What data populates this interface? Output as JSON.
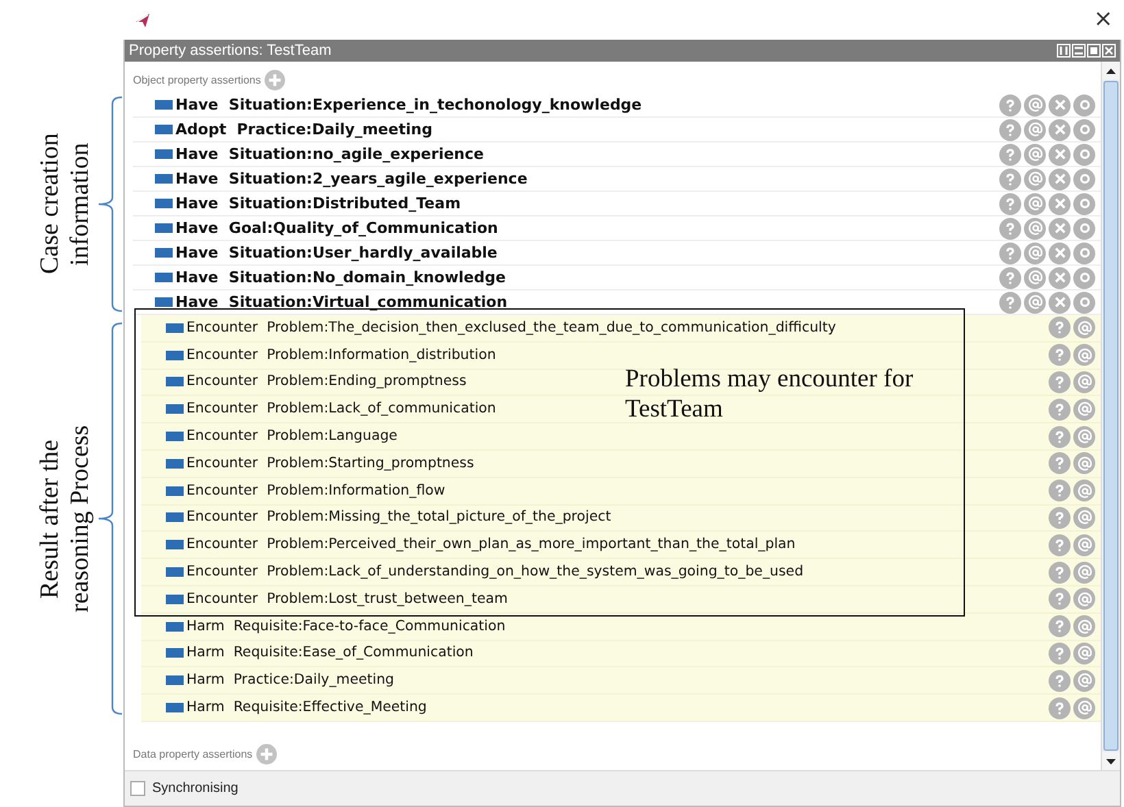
{
  "topbar": {
    "close": "×"
  },
  "panel": {
    "title": "Property assertions: TestTeam",
    "object_section": "Object property assertions",
    "assertions": [
      {
        "kind": "asserted",
        "text": "Have  Situation:Experience_in_techonology_knowledge"
      },
      {
        "kind": "asserted",
        "text": "Adopt  Practice:Daily_meeting"
      },
      {
        "kind": "asserted",
        "text": "Have  Situation:no_agile_experience"
      },
      {
        "kind": "asserted",
        "text": "Have  Situation:2_years_agile_experience"
      },
      {
        "kind": "asserted",
        "text": "Have  Situation:Distributed_Team"
      },
      {
        "kind": "asserted",
        "text": "Have  Goal:Quality_of_Communication"
      },
      {
        "kind": "asserted",
        "text": "Have  Situation:User_hardly_available"
      },
      {
        "kind": "asserted",
        "text": "Have  Situation:No_domain_knowledge"
      },
      {
        "kind": "asserted",
        "text": "Have  Situation:Virtual_communication"
      },
      {
        "kind": "inferred",
        "text": "Encounter  Problem:The_decision_then_exclused_the_team_due_to_communication_difficulty"
      },
      {
        "kind": "inferred",
        "text": "Encounter  Problem:Information_distribution"
      },
      {
        "kind": "inferred",
        "text": "Encounter  Problem:Ending_promptness"
      },
      {
        "kind": "inferred",
        "text": "Encounter  Problem:Lack_of_communication"
      },
      {
        "kind": "inferred",
        "text": "Encounter  Problem:Language"
      },
      {
        "kind": "inferred",
        "text": "Encounter  Problem:Starting_promptness"
      },
      {
        "kind": "inferred",
        "text": "Encounter  Problem:Information_flow"
      },
      {
        "kind": "inferred",
        "text": "Encounter  Problem:Missing_the_total_picture_of_the_project"
      },
      {
        "kind": "inferred",
        "text": "Encounter  Problem:Perceived_their_own_plan_as_more_important_than_the_total_plan"
      },
      {
        "kind": "inferred",
        "text": "Encounter  Problem:Lack_of_understanding_on_how_the_system_was_going_to_be_used"
      },
      {
        "kind": "inferred",
        "text": "Encounter  Problem:Lost_trust_between_team"
      },
      {
        "kind": "inferred",
        "text": "Harm  Requisite:Face-to-face_Communication"
      },
      {
        "kind": "inferred",
        "text": "Harm  Requisite:Ease_of_Communication"
      },
      {
        "kind": "inferred",
        "text": "Harm  Practice:Daily_meeting"
      },
      {
        "kind": "inferred",
        "text": "Harm  Requisite:Effective_Meeting"
      }
    ],
    "data_section": "Data property assertions",
    "synchronising": {
      "label": "Synchronising",
      "checked": false
    }
  },
  "annotations": [
    {
      "text": "Case creation information"
    },
    {
      "text": "Result after the reasoning Process"
    }
  ],
  "highlight": {
    "note": "Problems may encounter for TestTeam"
  }
}
